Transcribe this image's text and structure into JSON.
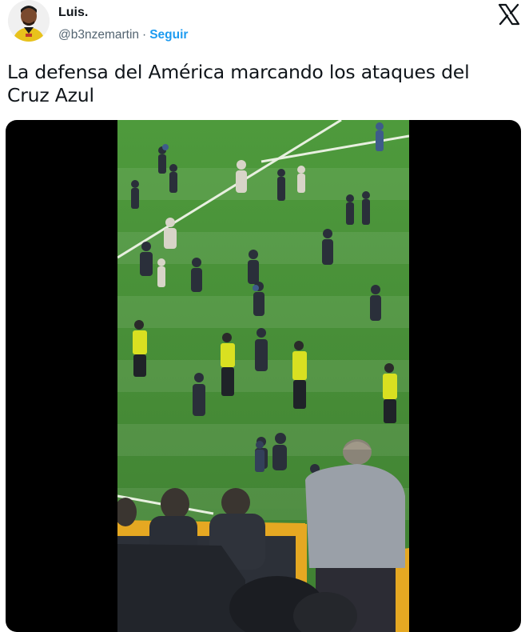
{
  "author": {
    "name": "Luis.",
    "handle": "@b3nzemartin",
    "separator": "·",
    "follow_label": "Seguir"
  },
  "tweet": {
    "text": "La defensa del América marcando los ataques del Cruz Azul"
  },
  "icons": {
    "platform_logo": "x-logo-icon"
  },
  "colors": {
    "text_primary": "#0f1419",
    "text_secondary": "#536471",
    "link": "#1d9bf0",
    "pitch": "#4a8a3a",
    "steward_vest": "#d9e021"
  }
}
